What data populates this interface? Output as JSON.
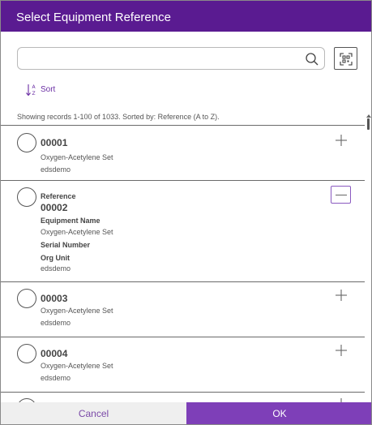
{
  "dialog": {
    "title": "Select Equipment Reference"
  },
  "search": {
    "value": "",
    "placeholder": ""
  },
  "toolbar": {
    "sort_label": "Sort"
  },
  "list": {
    "status": "Showing records 1-100 of 1033. Sorted by: Reference (A to Z).",
    "items": [
      {
        "reference": "00001",
        "equipment_name": "Oxygen-Acetylene Set",
        "org_unit": "edsdemo"
      },
      {
        "reference_label": "Reference",
        "reference": "00002",
        "equipment_name_label": "Equipment Name",
        "equipment_name": "Oxygen-Acetylene Set",
        "serial_number_label": "Serial Number",
        "org_unit_label": "Org Unit",
        "org_unit": "edsdemo"
      },
      {
        "reference": "00003",
        "equipment_name": "Oxygen-Acetylene Set",
        "org_unit": "edsdemo"
      },
      {
        "reference": "00004",
        "equipment_name": "Oxygen-Acetylene Set",
        "org_unit": "edsdemo"
      }
    ]
  },
  "footer": {
    "cancel_label": "Cancel",
    "ok_label": "OK"
  },
  "colors": {
    "accent": "#5a1b91",
    "ok_button": "#7e3fb8",
    "link": "#6b2fa4"
  },
  "icons": [
    "search-icon",
    "scan-icon",
    "sort-icon",
    "expand-icon",
    "collapse-icon",
    "radio-icon"
  ]
}
